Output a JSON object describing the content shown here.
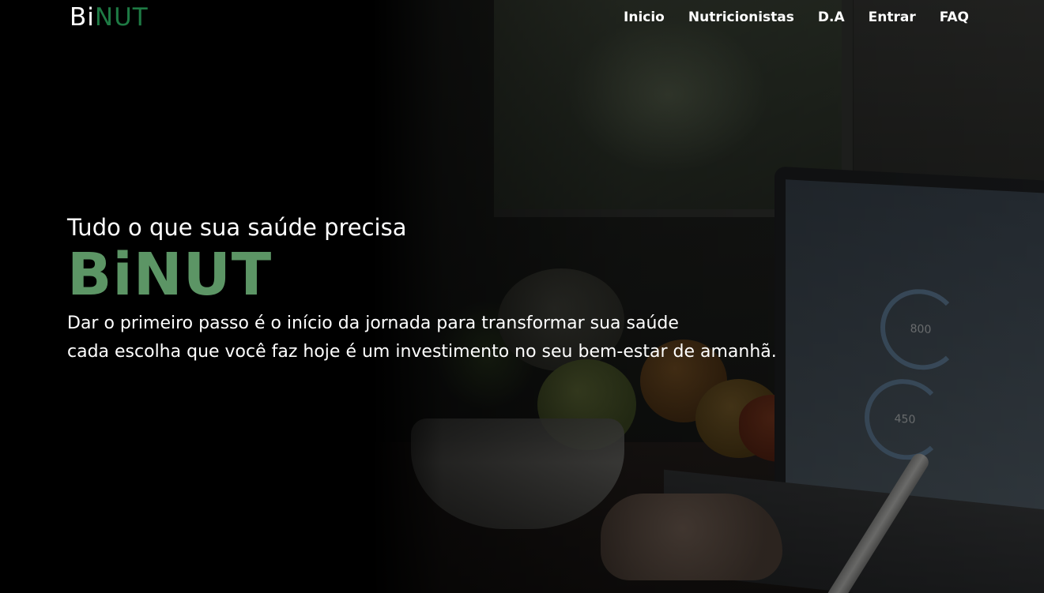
{
  "logo": {
    "part1": "Bi",
    "part2": "NUT",
    "colors": {
      "part1": "#ffffff",
      "part2": "#1e7a44"
    }
  },
  "nav": {
    "items": [
      {
        "label": "Inicio"
      },
      {
        "label": "Nutricionistas"
      },
      {
        "label": "D.A"
      },
      {
        "label": "Entrar"
      },
      {
        "label": "FAQ"
      }
    ]
  },
  "hero": {
    "tagline": "Tudo o que sua saúde precisa",
    "brand": "BiNUT",
    "brand_color": "#5c9565",
    "description_lines": [
      "Dar o primeiro passo é o início da jornada para transformar sua saúde",
      "cada escolha que você faz hoje é um investimento no seu bem-estar de amanhã."
    ]
  },
  "background": {
    "laptop_screen": {
      "gauge1": "800",
      "gauge2": "450"
    }
  }
}
